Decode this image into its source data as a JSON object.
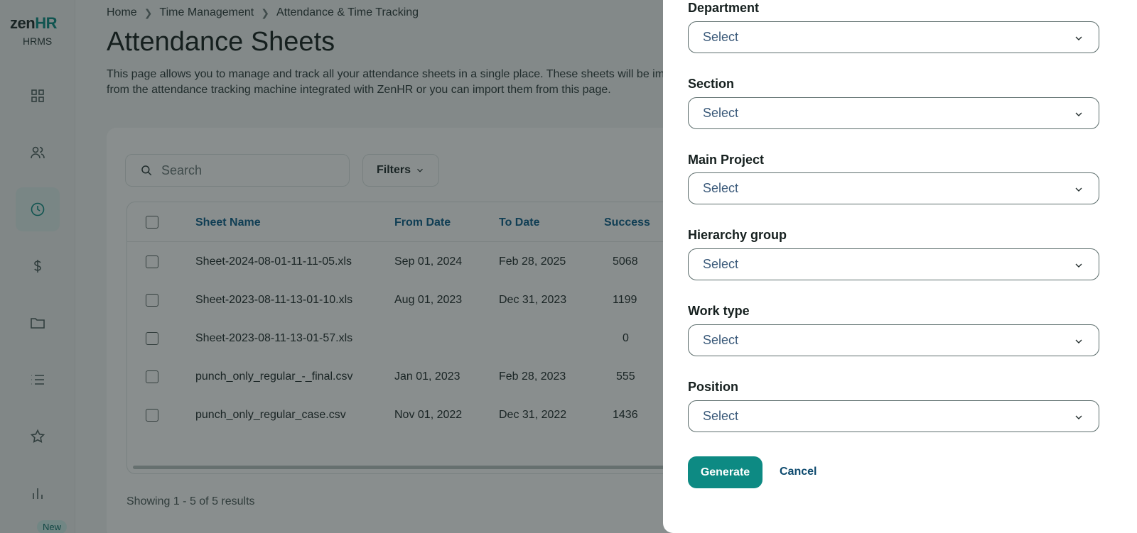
{
  "sidebar": {
    "logo_zen": "zen",
    "logo_hr": "HR",
    "logo_sub": "HRMS",
    "new_badge": "New",
    "icons": [
      "dashboard-icon",
      "people-icon",
      "clock-icon",
      "dollar-icon",
      "folder-icon",
      "list-icon",
      "star-icon",
      "chart-icon"
    ],
    "active_icon": "clock-icon"
  },
  "breadcrumb": [
    "Home",
    "Time Management",
    "Attendance & Time Tracking"
  ],
  "page": {
    "title": "Attendance Sheets",
    "description": "This page allows you to manage and track all your attendance sheets in a single place. These sheets will be imported directly from the attendance tracking machine integrated with ZenHR or you can import them from this page."
  },
  "toolbar": {
    "search_placeholder": "Search",
    "filters_label": "Filters"
  },
  "table": {
    "columns": [
      "Sheet Name",
      "From Date",
      "To Date",
      "Success"
    ],
    "rows": [
      {
        "name": "Sheet-2024-08-01-11-11-05.xls",
        "from": "Sep 01, 2024",
        "to": "Feb 28, 2025",
        "success": "5068"
      },
      {
        "name": "Sheet-2023-08-11-13-01-10.xls",
        "from": "Aug 01, 2023",
        "to": "Dec 31, 2023",
        "success": "1199"
      },
      {
        "name": "Sheet-2023-08-11-13-01-57.xls",
        "from": "",
        "to": "",
        "success": "0"
      },
      {
        "name": "punch_only_regular_-_final.csv",
        "from": "Jan 01, 2023",
        "to": "Feb 28, 2023",
        "success": "555"
      },
      {
        "name": "punch_only_regular_case.csv",
        "from": "Nov 01, 2022",
        "to": "Dec 31, 2022",
        "success": "1436"
      }
    ],
    "showing": "Showing 1 - 5 of 5 results"
  },
  "drawer": {
    "fields": [
      {
        "label": "Department",
        "placeholder": "Select"
      },
      {
        "label": "Section",
        "placeholder": "Select"
      },
      {
        "label": "Main Project",
        "placeholder": "Select"
      },
      {
        "label": "Hierarchy group",
        "placeholder": "Select"
      },
      {
        "label": "Work type",
        "placeholder": "Select"
      },
      {
        "label": "Position",
        "placeholder": "Select"
      }
    ],
    "generate_label": "Generate",
    "cancel_label": "Cancel"
  },
  "colors": {
    "brand": "#0d8a83",
    "header_link": "#0d5e8a"
  }
}
